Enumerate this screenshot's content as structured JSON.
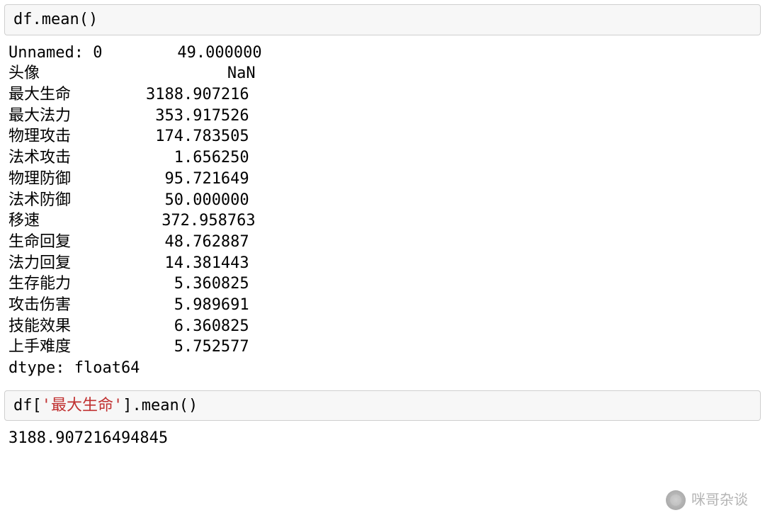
{
  "cell1": {
    "code_parts": {
      "p1": "df.mean",
      "p2": "()"
    }
  },
  "output1": {
    "rows": [
      {
        "label": "Unnamed: 0",
        "value": "49.000000"
      },
      {
        "label": "头像",
        "value": "NaN"
      },
      {
        "label": "最大生命",
        "value": "3188.907216"
      },
      {
        "label": "最大法力",
        "value": "353.917526"
      },
      {
        "label": "物理攻击",
        "value": "174.783505"
      },
      {
        "label": "法术攻击",
        "value": "1.656250"
      },
      {
        "label": "物理防御",
        "value": "95.721649"
      },
      {
        "label": "法术防御",
        "value": "50.000000"
      },
      {
        "label": "移速",
        "value": "372.958763"
      },
      {
        "label": "生命回复",
        "value": "48.762887"
      },
      {
        "label": "法力回复",
        "value": "14.381443"
      },
      {
        "label": "生存能力",
        "value": "5.360825"
      },
      {
        "label": "攻击伤害",
        "value": "5.989691"
      },
      {
        "label": "技能效果",
        "value": "6.360825"
      },
      {
        "label": "上手难度",
        "value": "5.752577"
      }
    ],
    "dtype_line": "dtype: float64"
  },
  "cell2": {
    "code_parts": {
      "p1": "df[",
      "p2": "'最大生命'",
      "p3": "].mean",
      "p4": "()"
    }
  },
  "output2": {
    "value": "3188.907216494845"
  },
  "watermark": {
    "text": "咪哥杂谈"
  },
  "layout": {
    "label_width_chars": 14,
    "value_width_chars": 13
  }
}
